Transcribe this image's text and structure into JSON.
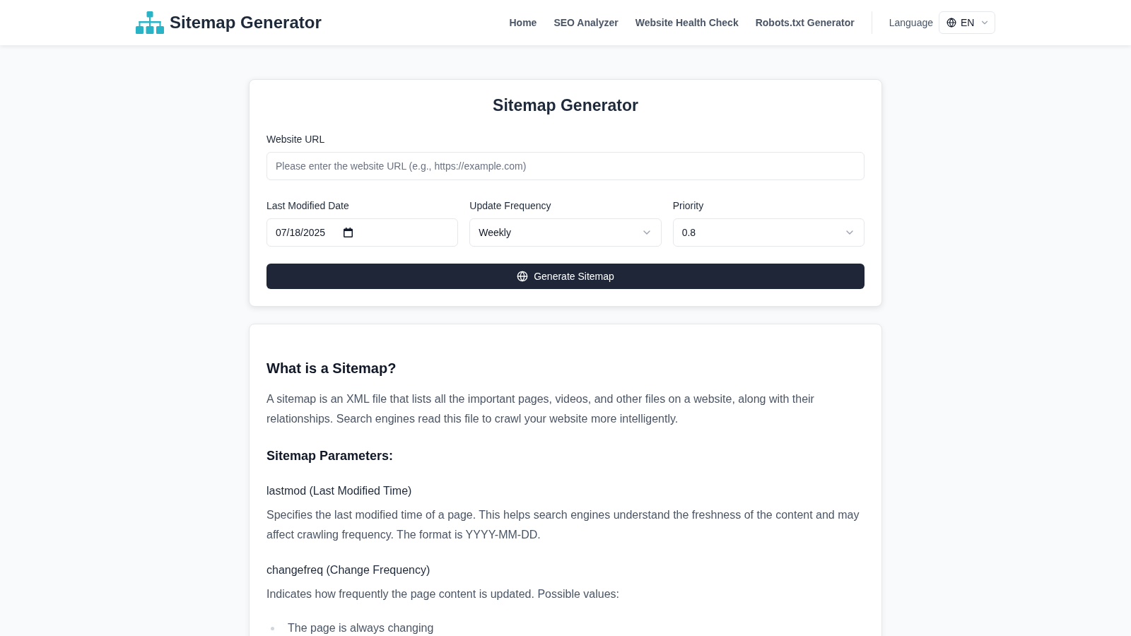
{
  "header": {
    "logo_text": "Sitemap Generator",
    "nav": [
      {
        "label": "Home"
      },
      {
        "label": "SEO Analyzer"
      },
      {
        "label": "Website Health Check"
      },
      {
        "label": "Robots.txt Generator"
      }
    ],
    "language_label": "Language",
    "language_select": {
      "value": "EN"
    }
  },
  "generator_card": {
    "title": "Sitemap Generator",
    "url_field": {
      "label": "Website URL",
      "placeholder": "Please enter the website URL (e.g., https://example.com)"
    },
    "fields": [
      {
        "kind": "date",
        "label": "Last Modified Date",
        "value": "07/18/2025"
      },
      {
        "kind": "select",
        "label": "Update Frequency",
        "value": "Weekly"
      },
      {
        "kind": "select",
        "label": "Priority",
        "value": "0.8"
      }
    ],
    "button": {
      "label": "Generate Sitemap"
    }
  },
  "info_card": {
    "title": "What is a Sitemap?",
    "intro": "A sitemap is an XML file that lists all the important pages, videos, and other files on a website, along with their relationships. Search engines read this file to crawl your website more intelligently.",
    "parameters_title": "Sitemap Parameters:",
    "parameters": [
      {
        "name": "lastmod (Last Modified Time)",
        "description": "Specifies the last modified time of a page. This helps search engines understand the freshness of the content and may affect crawling frequency. The format is YYYY-MM-DD."
      },
      {
        "name": "changefreq (Change Frequency)",
        "description": "Indicates how frequently the page content is updated. Possible values:",
        "values": [
          "The page is always changing"
        ]
      }
    ]
  }
}
